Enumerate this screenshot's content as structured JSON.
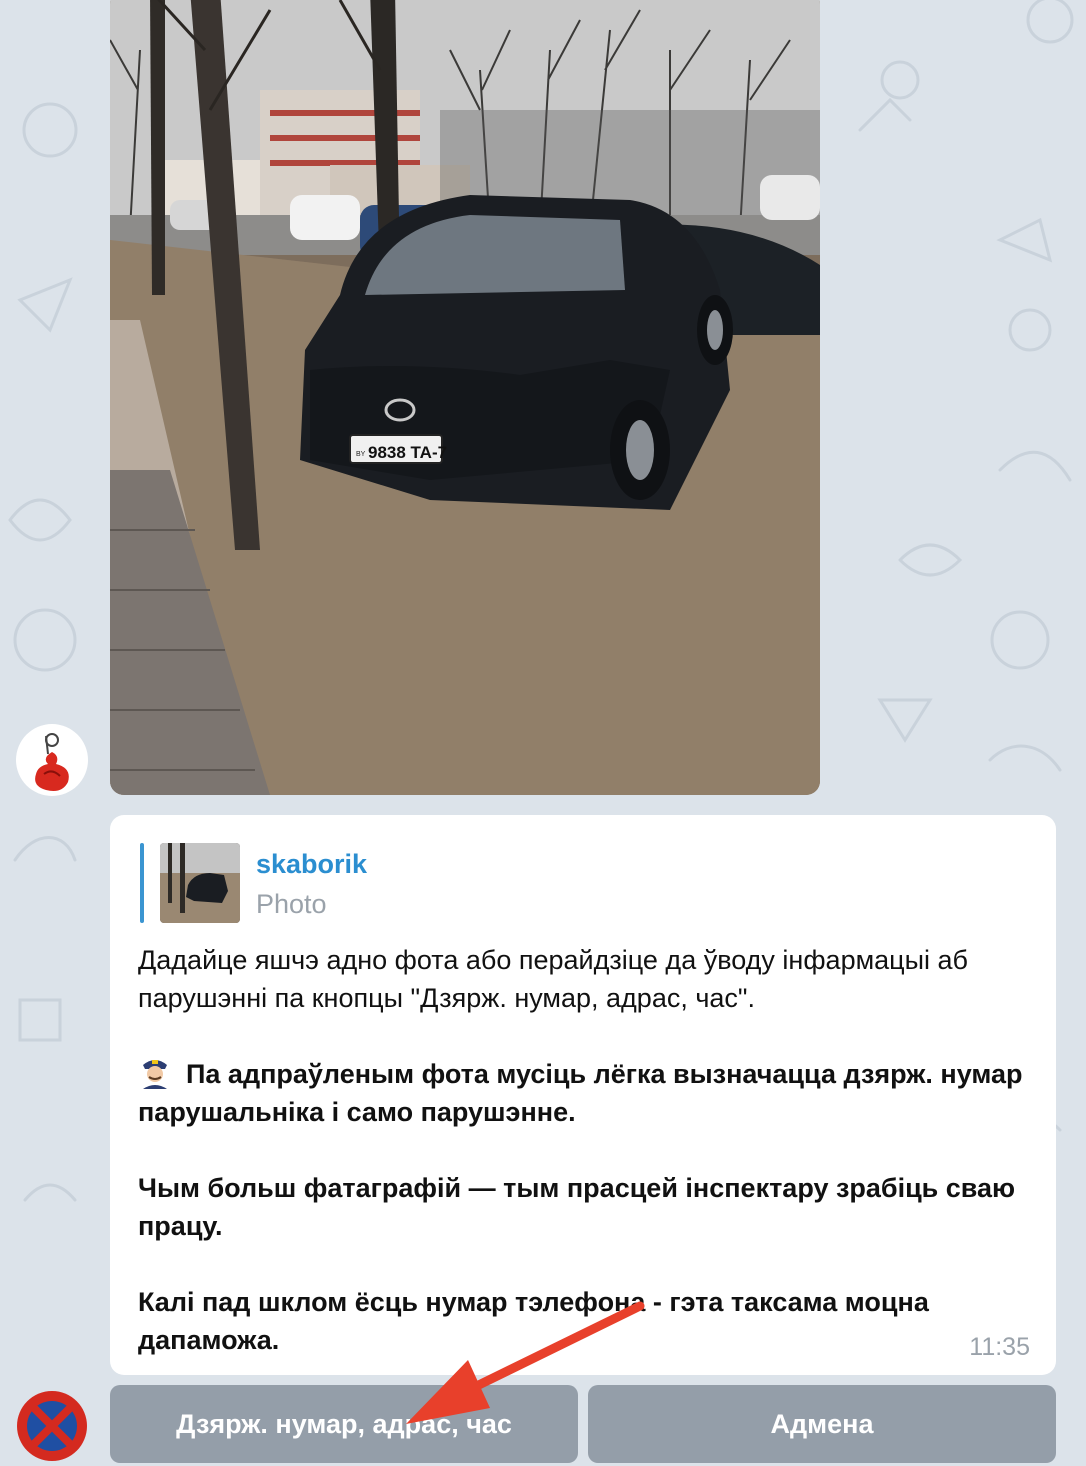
{
  "photo": {
    "plate": "9838 TA-7",
    "plate_country": "BY"
  },
  "reply": {
    "name": "skaborik",
    "type": "Photo"
  },
  "message": {
    "para1": "Дадайце яшчэ адно фота або перайдзіце да ўводу інфармацыі аб парушэнні па кнопцы \"Дзярж. нумар, адрас, час\".",
    "para2": "Па адпраўленым фота мусіць лёгка вызначацца дзярж. нумар парушальніка і само парушэнне.",
    "para3": "Чым больш фатаграфій — тым прасцей інспектару зрабіць сваю працу.",
    "para4": "Калі пад шклом ёсць нумар тэлефона - гэта таксама моцна дапаможа.",
    "time": "11:35"
  },
  "keyboard": {
    "button_plate": "Дзярж. нумар, адрас, час",
    "button_cancel": "Адмена"
  },
  "colors": {
    "accent": "#2b8ed0",
    "arrow": "#e8402b",
    "keyboard_button": "#7f8b96"
  },
  "icons": [
    "police-officer-emoji",
    "no-stopping-sign-icon",
    "bot-avatar-icon"
  ]
}
